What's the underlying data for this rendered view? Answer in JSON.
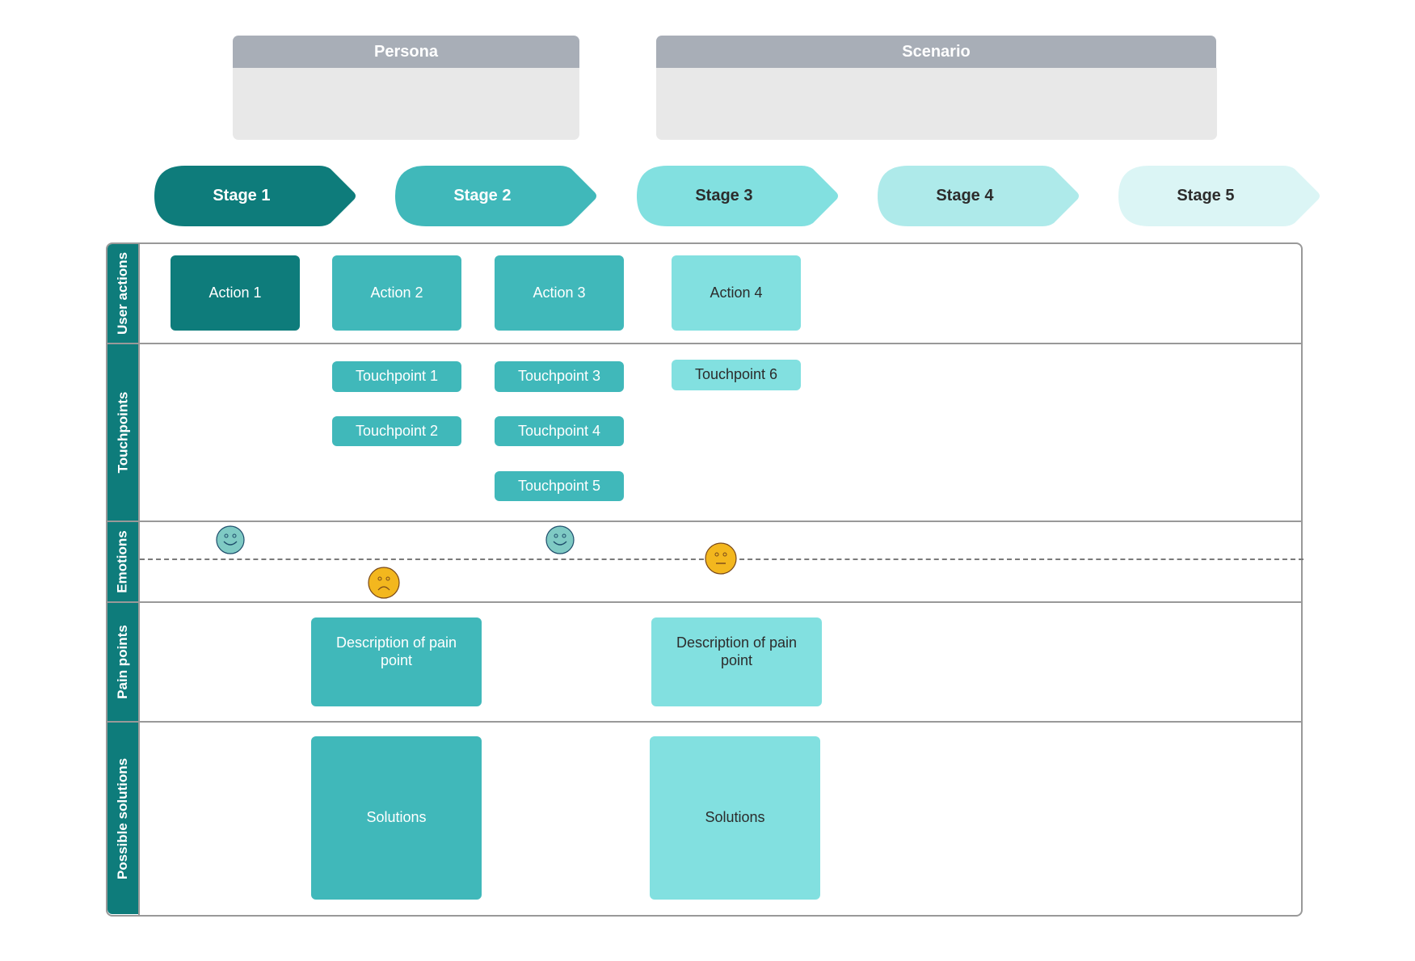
{
  "persona": {
    "title": "Persona",
    "body": ""
  },
  "scenario": {
    "title": "Scenario",
    "body": ""
  },
  "stages": [
    {
      "label": "Stage 1",
      "color": "#0e7c7b",
      "text_color": "#ffffff"
    },
    {
      "label": "Stage 2",
      "color": "#40b8ba",
      "text_color": "#ffffff"
    },
    {
      "label": "Stage 3",
      "color": "#82e0e0",
      "text_color": "#2c2c2c"
    },
    {
      "label": "Stage 4",
      "color": "#aeeaea",
      "text_color": "#2c2c2c"
    },
    {
      "label": "Stage 5",
      "color": "#dbf5f5",
      "text_color": "#2c2c2c"
    }
  ],
  "rows": {
    "user_actions": "User actions",
    "touchpoints": "Touchpoints",
    "emotions": "Emotions",
    "pain_points": "Pain points",
    "possible_solutions": "Possible solutions"
  },
  "actions": [
    "Action 1",
    "Action 2",
    "Action 3",
    "Action 4"
  ],
  "touchpoints": [
    "Touchpoint 1",
    "Touchpoint 2",
    "Touchpoint 3",
    "Touchpoint 4",
    "Touchpoint 5",
    "Touchpoint 6"
  ],
  "emotions": [
    {
      "stage": "Stage 1",
      "mood": "happy",
      "icon": "happy-face-icon",
      "color": "#7fcac4"
    },
    {
      "stage": "Stage 2",
      "mood": "sad",
      "icon": "sad-face-icon",
      "color": "#f3b71e"
    },
    {
      "stage": "Stage 3",
      "mood": "happy",
      "icon": "happy-face-icon",
      "color": "#7fcac4"
    },
    {
      "stage": "Stage 4",
      "mood": "neutral",
      "icon": "neutral-face-icon",
      "color": "#f3b71e"
    }
  ],
  "pain_points": [
    "Description of pain point",
    "Description of pain point"
  ],
  "solutions": [
    "Solutions",
    "Solutions"
  ],
  "colors": {
    "dark_teal": "#0e7c7b",
    "mid_teal": "#40b8ba",
    "light_teal": "#82e0e0",
    "header_gray": "#a8aeb7",
    "panel_gray": "#e8e8e8",
    "border_gray": "#999999"
  }
}
